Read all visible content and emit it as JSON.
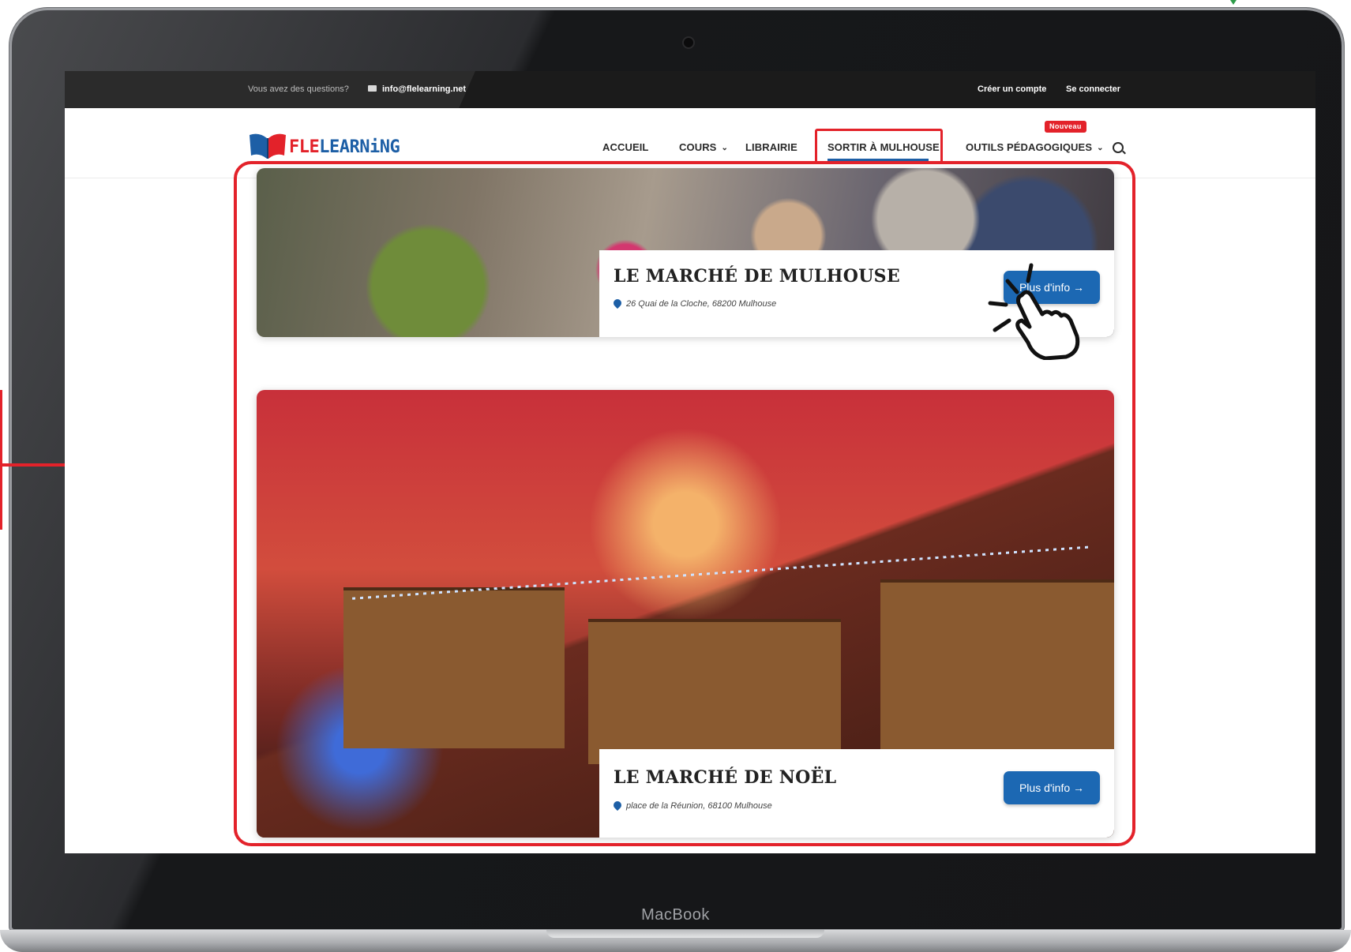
{
  "device": {
    "brand": "MacBook"
  },
  "topbar": {
    "question": "Vous avez des questions?",
    "email": "info@flelearning.net",
    "create_account": "Créer un compte",
    "login": "Se connecter"
  },
  "logo": {
    "part1": "FLE",
    "part2": "LEARNiNG"
  },
  "nav": {
    "accueil": "ACCUEIL",
    "cours": "COURS",
    "librairie": "LIBRAIRIE",
    "sortir": "SORTIR À MULHOUSE",
    "outils": "OUTILS PÉDAGOGIQUES",
    "badge": "Nouveau",
    "active_color": "#1d5fa6",
    "highlight_color": "#e3222a"
  },
  "places": [
    {
      "title": "LE MARCHÉ DE MULHOUSE",
      "address": "26 Quai de la Cloche, 68200 Mulhouse",
      "button": "Plus d'info →"
    },
    {
      "title": "LE MARCHÉ DE NOËL",
      "address": "place de la Réunion, 68100 Mulhouse",
      "button": "Plus d'info →"
    }
  ],
  "colors": {
    "accent": "#e3222a",
    "brand": "#1d5fa6",
    "button": "#1c68b3"
  }
}
